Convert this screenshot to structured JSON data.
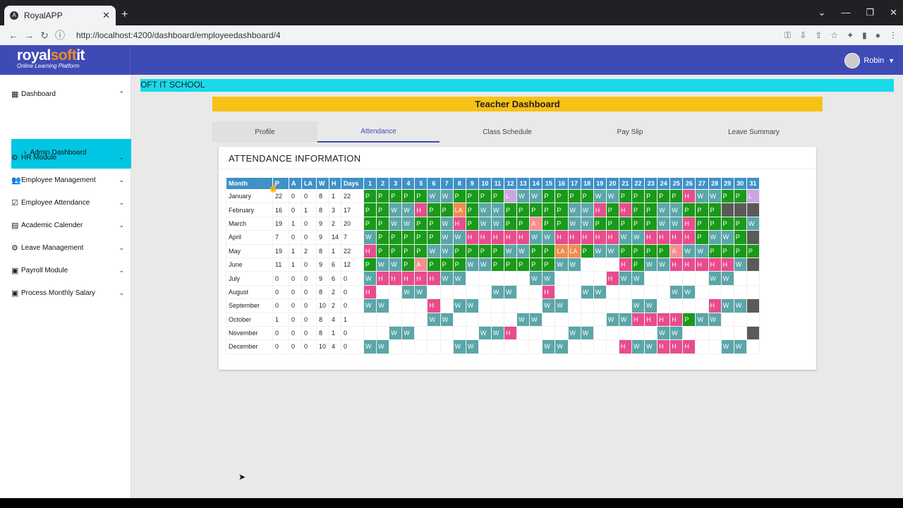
{
  "browser": {
    "tab_title": "RoyalAPP",
    "tab_close": "✕",
    "new_tab": "+",
    "url": "http://localhost:4200/dashboard/employeedashboard/4",
    "win_controls": [
      "⌄",
      "—",
      "❐",
      "✕"
    ]
  },
  "header": {
    "logo_royal": "royal",
    "logo_soft": "soft",
    "logo_it": "it",
    "logo_tagline": "Online Learning Platform",
    "user_name": "Robin"
  },
  "sidebar": {
    "items": [
      {
        "label": "Dashboard",
        "icon": "grid-icon",
        "glyph": "▦",
        "chevron": "⌃"
      },
      {
        "label": "HR Module",
        "icon": "user-cog-icon",
        "glyph": "⚙",
        "chevron": "⌄"
      },
      {
        "label": "Employee Management",
        "icon": "people-icon",
        "glyph": "👥",
        "chevron": "⌄"
      },
      {
        "label": "Employee Attendance",
        "icon": "calendar-check-icon",
        "glyph": "☑",
        "chevron": "⌄"
      },
      {
        "label": "Academic Calender",
        "icon": "calendar-icon",
        "glyph": "▤",
        "chevron": "⌄"
      },
      {
        "label": "Leave Management",
        "icon": "gear-icon",
        "glyph": "⚙",
        "chevron": "⌄"
      },
      {
        "label": "Payroll Module",
        "icon": "payroll-icon",
        "glyph": "▣",
        "chevron": "⌄"
      },
      {
        "label": "Process Monthly Salary",
        "icon": "payroll-icon",
        "glyph": "▣",
        "chevron": "⌄"
      }
    ],
    "submenu_label": "Admin Dashboard"
  },
  "main": {
    "school_name": "OFT IT SCHOOL",
    "dashboard_title": "Teacher Dashboard",
    "tabs": [
      {
        "label": "Profile"
      },
      {
        "label": "Attendance"
      },
      {
        "label": "Class Schedule"
      },
      {
        "label": "Pay Slip"
      },
      {
        "label": "Leave Summary"
      }
    ],
    "active_tab": 1,
    "card_title": "ATTENDANCE INFORMATION"
  },
  "attendance": {
    "headers": [
      "Month",
      "P",
      "A",
      "LA",
      "W",
      "H",
      "Days"
    ],
    "days": [
      "1",
      "2",
      "3",
      "4",
      "5",
      "6",
      "7",
      "8",
      "9",
      "10",
      "11",
      "12",
      "13",
      "14",
      "15",
      "16",
      "17",
      "18",
      "19",
      "20",
      "21",
      "22",
      "23",
      "24",
      "25",
      "26",
      "27",
      "28",
      "29",
      "30",
      "31"
    ],
    "colors": {
      "P": "#1a9a1a",
      "W": "#5aa6a8",
      "H": "#e84c8c",
      "A": "#f58f8f",
      "LA": "#f28c4e",
      "L": "#c9a6e0",
      "blocked": "#5a5a5a"
    },
    "rows": [
      {
        "month": "January",
        "stats": [
          "22",
          "0",
          "0",
          "8",
          "1",
          "22"
        ],
        "days": [
          "P",
          "P",
          "P",
          "P",
          "P",
          "W",
          "W",
          "P",
          "P",
          "P",
          "P",
          "L",
          "W",
          "W",
          "P",
          "P",
          "P",
          "P",
          "W",
          "W",
          "P",
          "P",
          "P",
          "P",
          "P",
          "H",
          "W",
          "W",
          "P",
          "P",
          "L"
        ]
      },
      {
        "month": "February",
        "stats": [
          "16",
          "0",
          "1",
          "8",
          "3",
          "17"
        ],
        "days": [
          "P",
          "P",
          "W",
          "W",
          "H",
          "P",
          "P",
          "LA",
          "P",
          "W",
          "W",
          "P",
          "P",
          "P",
          "P",
          "P",
          "W",
          "W",
          "H",
          "P",
          "H",
          "P",
          "P",
          "W",
          "W",
          "P",
          "P",
          "P",
          "X",
          "X",
          "X"
        ]
      },
      {
        "month": "March",
        "stats": [
          "19",
          "1",
          "0",
          "9",
          "2",
          "20"
        ],
        "days": [
          "P",
          "P",
          "W",
          "W",
          "P",
          "P",
          "W",
          "H",
          "P",
          "W",
          "W",
          "P",
          "P",
          "A",
          "P",
          "P",
          "W",
          "W",
          "P",
          "P",
          "P",
          "P",
          "P",
          "W",
          "W",
          "H",
          "P",
          "P",
          "P",
          "P",
          "W"
        ]
      },
      {
        "month": "April",
        "stats": [
          "7",
          "0",
          "0",
          "9",
          "14",
          "7"
        ],
        "days": [
          "W",
          "P",
          "P",
          "P",
          "P",
          "P",
          "W",
          "W",
          "H",
          "H",
          "H",
          "H",
          "H",
          "W",
          "W",
          "H",
          "H",
          "H",
          "H",
          "H",
          "W",
          "W",
          "H",
          "H",
          "H",
          "H",
          "P",
          "W",
          "W",
          "P",
          "X"
        ]
      },
      {
        "month": "May",
        "stats": [
          "19",
          "1",
          "2",
          "8",
          "1",
          "22"
        ],
        "days": [
          "H",
          "P",
          "P",
          "P",
          "P",
          "W",
          "W",
          "P",
          "P",
          "P",
          "P",
          "W",
          "W",
          "P",
          "P",
          "LA",
          "LA",
          "P",
          "W",
          "W",
          "P",
          "P",
          "P",
          "P",
          "A",
          "W",
          "W",
          "P",
          "P",
          "P",
          "P"
        ]
      },
      {
        "month": "June",
        "stats": [
          "11",
          "1",
          "0",
          "9",
          "6",
          "12"
        ],
        "days": [
          "P",
          "W",
          "W",
          "P",
          "A",
          "P",
          "P",
          "P",
          "W",
          "W",
          "P",
          "P",
          "P",
          "P",
          "P",
          "W",
          "W",
          "_",
          "_",
          "_",
          "H",
          "P",
          "W",
          "W",
          "H",
          "H",
          "H",
          "H",
          "H",
          "W",
          "X"
        ]
      },
      {
        "month": "July",
        "stats": [
          "0",
          "0",
          "0",
          "9",
          "6",
          "0"
        ],
        "days": [
          "W",
          "H",
          "H",
          "H",
          "H",
          "H",
          "W",
          "W",
          "_",
          "_",
          "_",
          "_",
          "_",
          "W",
          "W",
          "_",
          "_",
          "_",
          "_",
          "H",
          "W",
          "W",
          "_",
          "_",
          "_",
          "_",
          "_",
          "W",
          "W",
          "_",
          "_"
        ]
      },
      {
        "month": "August",
        "stats": [
          "0",
          "0",
          "0",
          "8",
          "2",
          "0"
        ],
        "days": [
          "H",
          "_",
          "_",
          "W",
          "W",
          "_",
          "_",
          "_",
          "_",
          "_",
          "W",
          "W",
          "_",
          "_",
          "H",
          "_",
          "_",
          "W",
          "W",
          "_",
          "_",
          "_",
          "_",
          "_",
          "W",
          "W",
          "_",
          "_",
          "_",
          "_",
          "_"
        ]
      },
      {
        "month": "September",
        "stats": [
          "0",
          "0",
          "0",
          "10",
          "2",
          "0"
        ],
        "days": [
          "W",
          "W",
          "_",
          "_",
          "_",
          "H",
          "_",
          "W",
          "W",
          "_",
          "_",
          "_",
          "_",
          "_",
          "W",
          "W",
          "_",
          "_",
          "_",
          "_",
          "_",
          "W",
          "W",
          "_",
          "_",
          "_",
          "_",
          "H",
          "W",
          "W",
          "X"
        ]
      },
      {
        "month": "October",
        "stats": [
          "1",
          "0",
          "0",
          "8",
          "4",
          "1"
        ],
        "days": [
          "_",
          "_",
          "_",
          "_",
          "_",
          "W",
          "W",
          "_",
          "_",
          "_",
          "_",
          "_",
          "W",
          "W",
          "_",
          "_",
          "_",
          "_",
          "_",
          "W",
          "W",
          "H",
          "H",
          "H",
          "H",
          "P",
          "W",
          "W",
          "_",
          "_",
          "_"
        ]
      },
      {
        "month": "November",
        "stats": [
          "0",
          "0",
          "0",
          "8",
          "1",
          "0"
        ],
        "days": [
          "_",
          "_",
          "W",
          "W",
          "_",
          "_",
          "_",
          "_",
          "_",
          "W",
          "W",
          "H",
          "_",
          "_",
          "_",
          "_",
          "W",
          "W",
          "_",
          "_",
          "_",
          "_",
          "_",
          "W",
          "W",
          "_",
          "_",
          "_",
          "_",
          "_",
          "X"
        ]
      },
      {
        "month": "December",
        "stats": [
          "0",
          "0",
          "0",
          "10",
          "4",
          "0"
        ],
        "days": [
          "W",
          "W",
          "_",
          "_",
          "_",
          "_",
          "_",
          "W",
          "W",
          "_",
          "_",
          "_",
          "_",
          "_",
          "W",
          "W",
          "_",
          "_",
          "_",
          "_",
          "H",
          "W",
          "W",
          "H",
          "H",
          "H",
          "_",
          "_",
          "W",
          "W",
          "_"
        ]
      }
    ]
  }
}
